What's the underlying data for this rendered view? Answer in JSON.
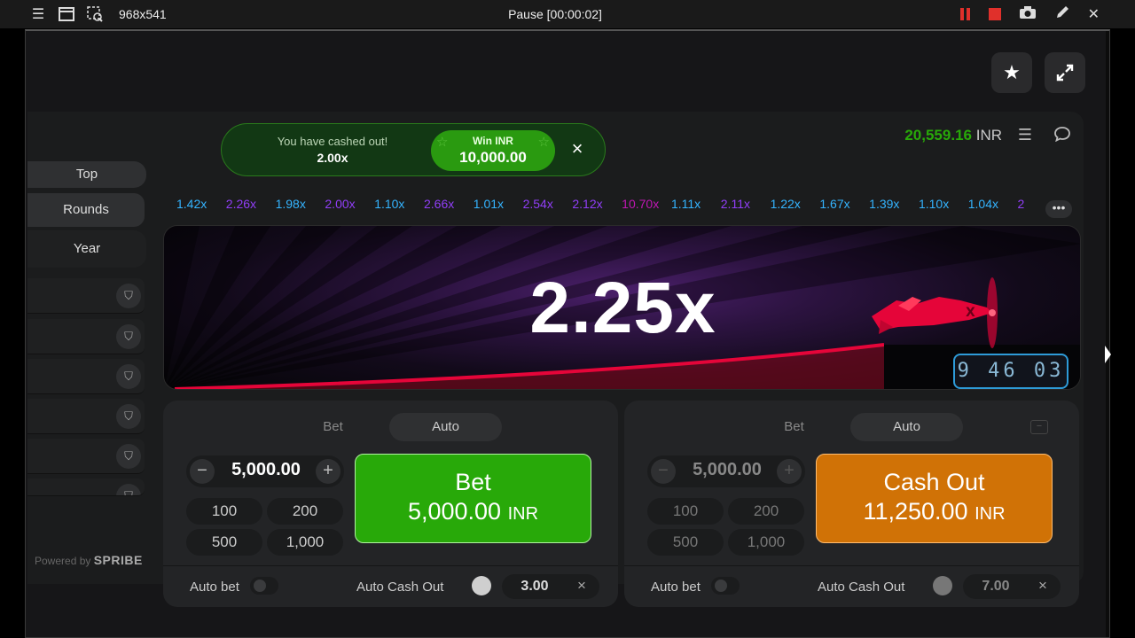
{
  "recorder": {
    "size_label": "968x541",
    "title": "Pause [00:00:02]",
    "icons": [
      "menu-icon",
      "window-icon",
      "region-select-icon",
      "pause-icon",
      "stop-icon",
      "camera-icon",
      "pencil-icon",
      "close-icon"
    ]
  },
  "toast": {
    "message": "You have cashed out!",
    "multiplier": "2.00x",
    "win_label": "Win INR",
    "win_value": "10,000.00",
    "close": "×"
  },
  "header": {
    "balance": "20,559.16",
    "currency": "INR"
  },
  "sidebar": {
    "tabs": [
      "Top",
      "Rounds",
      "Year"
    ],
    "powered_prefix": "Powered by",
    "powered_brand": "SPRIBE"
  },
  "history": [
    {
      "value": "1.42x",
      "color": "#34b4ff"
    },
    {
      "value": "2.26x",
      "color": "#913ef8"
    },
    {
      "value": "1.98x",
      "color": "#34b4ff"
    },
    {
      "value": "2.00x",
      "color": "#913ef8"
    },
    {
      "value": "1.10x",
      "color": "#34b4ff"
    },
    {
      "value": "2.66x",
      "color": "#913ef8"
    },
    {
      "value": "1.01x",
      "color": "#34b4ff"
    },
    {
      "value": "2.54x",
      "color": "#913ef8"
    },
    {
      "value": "2.12x",
      "color": "#913ef8"
    },
    {
      "value": "10.70x",
      "color": "#c017b4"
    },
    {
      "value": "1.11x",
      "color": "#34b4ff"
    },
    {
      "value": "2.11x",
      "color": "#913ef8"
    },
    {
      "value": "1.22x",
      "color": "#34b4ff"
    },
    {
      "value": "1.67x",
      "color": "#34b4ff"
    },
    {
      "value": "1.39x",
      "color": "#34b4ff"
    },
    {
      "value": "1.10x",
      "color": "#34b4ff"
    },
    {
      "value": "1.04x",
      "color": "#34b4ff"
    },
    {
      "value": "2",
      "color": "#913ef8"
    }
  ],
  "more_label": "•••",
  "flight": {
    "multiplier": "2.25x",
    "timer": "9 46 03"
  },
  "panels": [
    {
      "tab_bet": "Bet",
      "tab_auto": "Auto",
      "amount": "5,000.00",
      "chips": [
        "100",
        "200",
        "500",
        "1,000"
      ],
      "button_line1": "Bet",
      "button_amount": "5,000.00",
      "button_currency": "INR",
      "auto_bet_label": "Auto bet",
      "auto_cashout_label": "Auto Cash Out",
      "auto_cashout_value": "3.00",
      "clear": "×"
    },
    {
      "tab_bet": "Bet",
      "tab_auto": "Auto",
      "amount": "5,000.00",
      "chips": [
        "100",
        "200",
        "500",
        "1,000"
      ],
      "button_line1": "Cash Out",
      "button_amount": "11,250.00",
      "button_currency": "INR",
      "auto_bet_label": "Auto bet",
      "auto_cashout_label": "Auto Cash Out",
      "auto_cashout_value": "7.00",
      "clear": "×"
    }
  ],
  "colors": {
    "bet_green": "#28a909",
    "cashout_orange": "#d07206",
    "balance_green": "#28a909",
    "plane_red": "#e50539"
  }
}
